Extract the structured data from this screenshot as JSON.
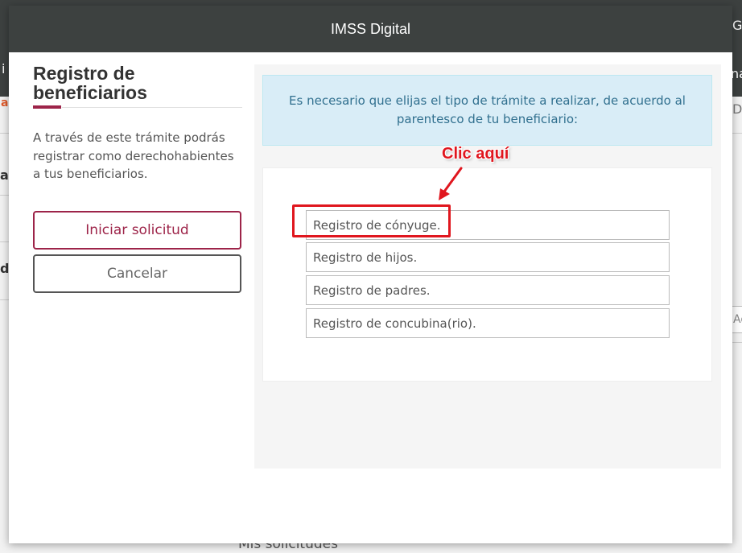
{
  "modal": {
    "title": "IMSS Digital",
    "heading": "Registro de beneficiarios",
    "description": "A través de este trámite podrás registrar como derechohabientes a tus beneficiarios.",
    "start_label": "Iniciar solicitud",
    "cancel_label": "Cancelar",
    "alert_text": "Es necesario que elijas el tipo de trámite a realizar, de acuerdo al parentesco de tu beneficiario:",
    "options": [
      "Registro de cónyuge.",
      "Registro de hijos.",
      "Registro de padres.",
      "Registro de concubina(rio)."
    ]
  },
  "annotation": {
    "label": "Clic aquí",
    "color": "#e0161e"
  },
  "background": {
    "bottom_heading": "Mis solicitudes",
    "frag_top_right": "G",
    "frag_right_na": "na",
    "frag_right_de": "De",
    "frag_right_ad": "Ad",
    "frag_left_al": "al",
    "frag_left_ac": "ac",
    "frag_left_di": "di",
    "frag_left_i": "i"
  },
  "colors": {
    "header_bg": "#3d4140",
    "accent": "#9d2449",
    "alert_bg": "#d9edf7"
  }
}
